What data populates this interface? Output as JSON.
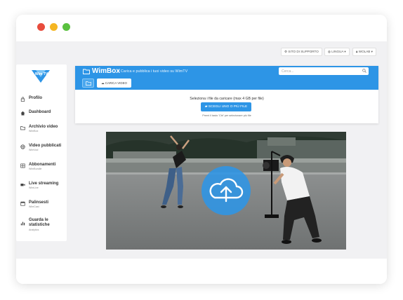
{
  "app": {
    "title": "WimBox",
    "subtitle": "Carica e pubblica i tuoi video su WimTV",
    "logo_text": "Wim TV"
  },
  "top_bar": {
    "support": "SITO DI SUPPORTO",
    "language": "LINGUA",
    "user": "WOLAB"
  },
  "sidebar": {
    "items": [
      {
        "icon": "lock-icon",
        "label": "Profilo",
        "sub": ""
      },
      {
        "icon": "home-icon",
        "label": "Dashboard",
        "sub": ""
      },
      {
        "icon": "folder-icon",
        "label": "Archivio video",
        "sub": "WimBox"
      },
      {
        "icon": "globe-icon",
        "label": "Video pubblicati",
        "sub": "WimVod"
      },
      {
        "icon": "bundle-icon",
        "label": "Abbonamenti",
        "sub": "WimBundle"
      },
      {
        "icon": "camera-icon",
        "label": "Live streaming",
        "sub": "WimLive"
      },
      {
        "icon": "calendar-icon",
        "label": "Palinsesti",
        "sub": "WimCast"
      },
      {
        "icon": "bar-chart-icon",
        "label": "Guarda le statistiche",
        "sub": "Analytics"
      }
    ]
  },
  "toolbar": {
    "search_placeholder": "Cerca...",
    "upload_tab_label": "CARICA VIDEO"
  },
  "upload": {
    "instruction": "Seleziona i file da caricare (max 4 GB per file)",
    "choose_button": "SCEGLI UNO O PIÙ FILE",
    "hint": "Premi il tasto 'Ctrl' per selezionare più file"
  },
  "colors": {
    "accent": "#2d95e6",
    "background": "#f1f1f3"
  }
}
